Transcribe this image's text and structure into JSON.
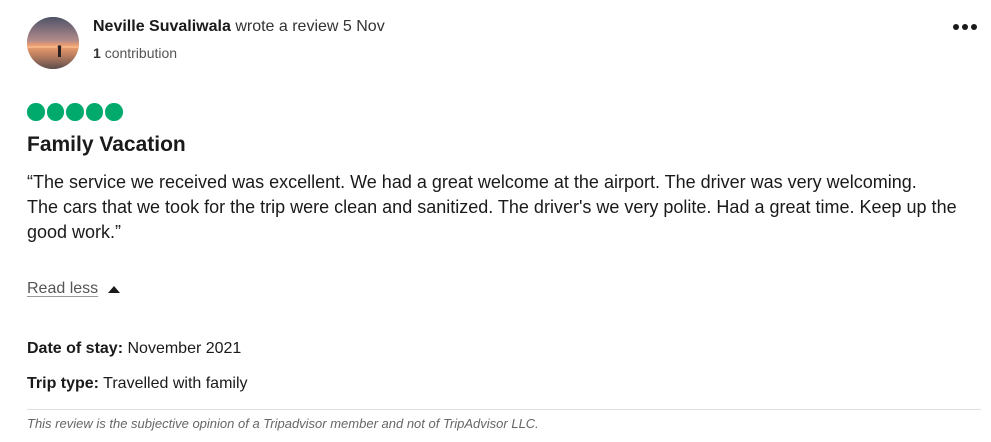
{
  "review": {
    "author": {
      "name": "Neville Suvaliwala",
      "action": "wrote a review 5 Nov",
      "contribution_count": "1",
      "contribution_label": "contribution"
    },
    "rating": {
      "bubbles": 5,
      "max": 5,
      "color": "#00aa6c"
    },
    "title": "Family Vacation",
    "text_paragraphs": [
      "“The service we received was excellent. We had a great welcome at the airport. The driver was very welcoming.",
      "The cars that we took for the trip were clean and sanitized. The driver's we very polite. Had a great time. Keep up the good work.”"
    ],
    "read_less_label": "Read less",
    "date_of_stay": {
      "label": "Date of stay:",
      "value": "November 2021"
    },
    "trip_type": {
      "label": "Trip type:",
      "value": "Travelled with family"
    },
    "disclaimer": "This review is the subjective opinion of a Tripadvisor member and not of TripAdvisor LLC.",
    "icons": {
      "more": "more-horizontal-icon",
      "caret": "caret-up-icon",
      "avatar": "user-avatar-photo"
    }
  }
}
